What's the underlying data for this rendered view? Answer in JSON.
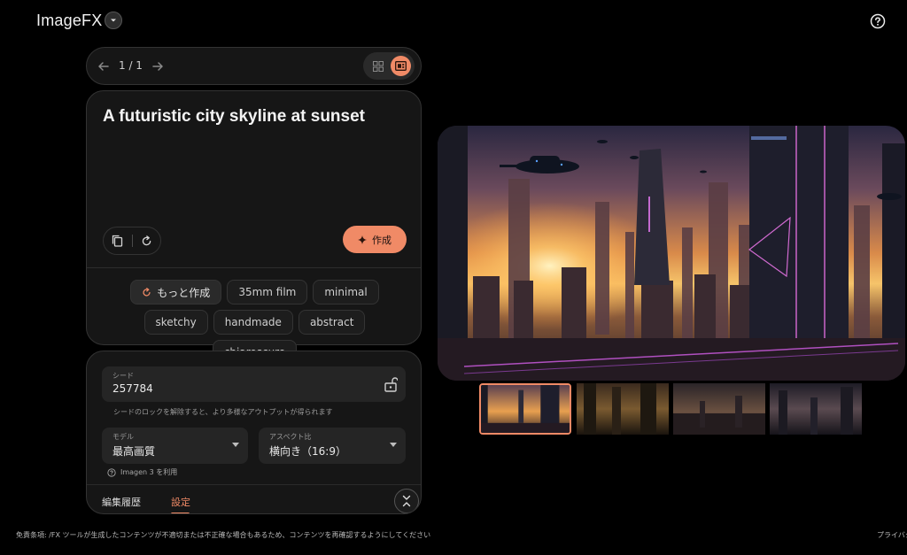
{
  "header": {
    "app_title": "ImageFX",
    "menu_icon": "chevron-down-icon",
    "help_icon": "help-circle-icon"
  },
  "pager": {
    "count": "1 / 1",
    "prev_icon": "arrow-left-icon",
    "next_icon": "arrow-right-icon",
    "view_modes": [
      "grid-view-icon",
      "single-view-icon"
    ],
    "active_view": "single"
  },
  "prompt": {
    "text": "A futuristic city skyline at sunset",
    "copy_icon": "copy-icon",
    "reset_icon": "refresh-icon",
    "create_label": "作成",
    "create_icon": "sparkle-icon"
  },
  "chips": {
    "more_label": "もっと作成",
    "items": [
      "35mm film",
      "minimal",
      "sketchy",
      "handmade",
      "abstract",
      "chiaroscuro"
    ]
  },
  "settings": {
    "seed_label": "シード",
    "seed_value": "257784",
    "seed_hint": "シードのロックを解除すると、より多様なアウトプットが得られます",
    "model_label": "モデル",
    "model_value": "最高画質",
    "aspect_label": "アスペクト比",
    "aspect_value": "横向き（16:9）",
    "imagen_note": "Imagen 3 を利用",
    "tabs": [
      "編集履歴",
      "設定"
    ],
    "active_tab": "設定"
  },
  "thumbnails": {
    "count": 4,
    "selected_index": 0
  },
  "footer": {
    "disclaimer": "免責条項: /FX ツールが生成したコンテンツが不適切または不正確な場合もあるため、コンテンツを再確認するようにしてください",
    "privacy": "プライバシー"
  },
  "colors": {
    "accent": "#f08a66",
    "background": "#000000",
    "panel": "#161616"
  }
}
